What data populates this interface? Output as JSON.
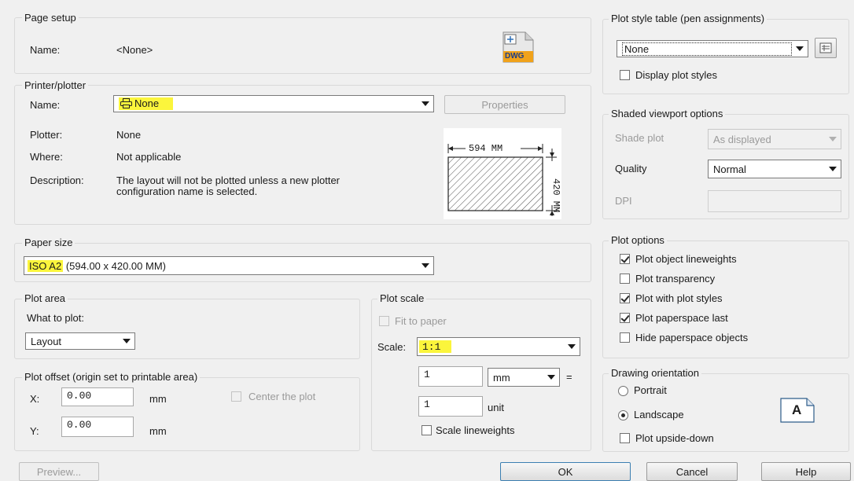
{
  "page_setup": {
    "label": "Page setup",
    "name_label": "Name:",
    "name_value": "<None>",
    "dwg_icon_text": "DWG"
  },
  "printer": {
    "label": "Printer/plotter",
    "name_label": "Name:",
    "name_value": "None",
    "properties_button": "Properties",
    "plotter_label": "Plotter:",
    "plotter_value": "None",
    "where_label": "Where:",
    "where_value": "Not applicable",
    "description_label": "Description:",
    "description_line1": "The layout will not be plotted unless a new plotter",
    "description_line2": "configuration name is selected.",
    "preview_width": "594 MM",
    "preview_height": "420 MM"
  },
  "paper_size": {
    "label": "Paper size",
    "value_highlighted": "ISO A2",
    "value_rest": " (594.00 x 420.00 MM)"
  },
  "plot_area": {
    "label": "Plot area",
    "what_label": "What to plot:",
    "what_value": "Layout"
  },
  "plot_offset": {
    "label": "Plot offset (origin set to printable area)",
    "x_label": "X:",
    "x_value": "0.00",
    "x_unit": "mm",
    "y_label": "Y:",
    "y_value": "0.00",
    "y_unit": "mm",
    "center_label": "Center the plot"
  },
  "plot_scale": {
    "label": "Plot scale",
    "fit_label": "Fit to paper",
    "scale_label": "Scale:",
    "scale_value": "1:1",
    "value1": "1",
    "unit_select": "mm",
    "equals": "=",
    "value2": "1",
    "unit2": "unit",
    "lineweights_label": "Scale lineweights"
  },
  "plot_style_table": {
    "label": "Plot style table (pen assignments)",
    "value": "None",
    "display_label": "Display plot styles"
  },
  "shaded_viewport": {
    "label": "Shaded viewport options",
    "shade_label": "Shade plot",
    "shade_value": "As displayed",
    "quality_label": "Quality",
    "quality_value": "Normal",
    "dpi_label": "DPI"
  },
  "plot_options": {
    "label": "Plot options",
    "items": [
      {
        "label": "Plot object lineweights",
        "checked": true
      },
      {
        "label": "Plot transparency",
        "checked": false
      },
      {
        "label": "Plot with plot styles",
        "checked": true
      },
      {
        "label": "Plot paperspace last",
        "checked": true
      },
      {
        "label": "Hide paperspace objects",
        "checked": false
      }
    ]
  },
  "orientation": {
    "label": "Drawing orientation",
    "portrait": "Portrait",
    "landscape": "Landscape",
    "upside_down": "Plot upside-down",
    "icon_letter": "A"
  },
  "buttons": {
    "preview": "Preview...",
    "ok": "OK",
    "cancel": "Cancel",
    "help": "Help"
  },
  "colors": {
    "highlight": "#fbf53c",
    "background": "#f0f0f0"
  }
}
